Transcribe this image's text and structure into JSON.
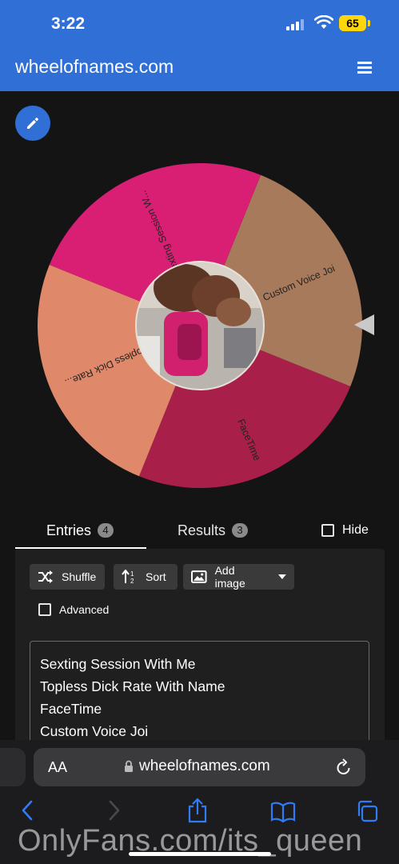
{
  "status": {
    "time": "3:22",
    "battery": "65"
  },
  "header": {
    "title": "wheelofnames.com",
    "menu_icon": "hamburger-menu-icon"
  },
  "edit_icon": "pencil-icon",
  "wheel": {
    "pointer_icon": "triangle-pointer-icon",
    "center_image": "photo",
    "slices": [
      {
        "label": "Custom Voice Joi",
        "color": "#a87a5c"
      },
      {
        "label": "FaceTime",
        "color": "#a8204a"
      },
      {
        "label": "Topless Dick Rate...",
        "color": "#e0896a"
      },
      {
        "label": "Sexting Session W...",
        "color": "#d81f73"
      }
    ]
  },
  "tabs": {
    "entries_label": "Entries",
    "entries_count": "4",
    "results_label": "Results",
    "results_count": "3",
    "hide_label": "Hide"
  },
  "toolbar": {
    "shuffle_label": "Shuffle",
    "sort_label": "Sort",
    "add_image_label": "Add image",
    "advanced_label": "Advanced"
  },
  "entries": [
    "Sexting Session With Me",
    "Topless Dick Rate With Name",
    "FaceTime",
    "Custom Voice Joi"
  ],
  "browser": {
    "text_size_label": "AA",
    "url": "wheelofnames.com"
  },
  "watermark": "OnlyFans.com/its_queen"
}
